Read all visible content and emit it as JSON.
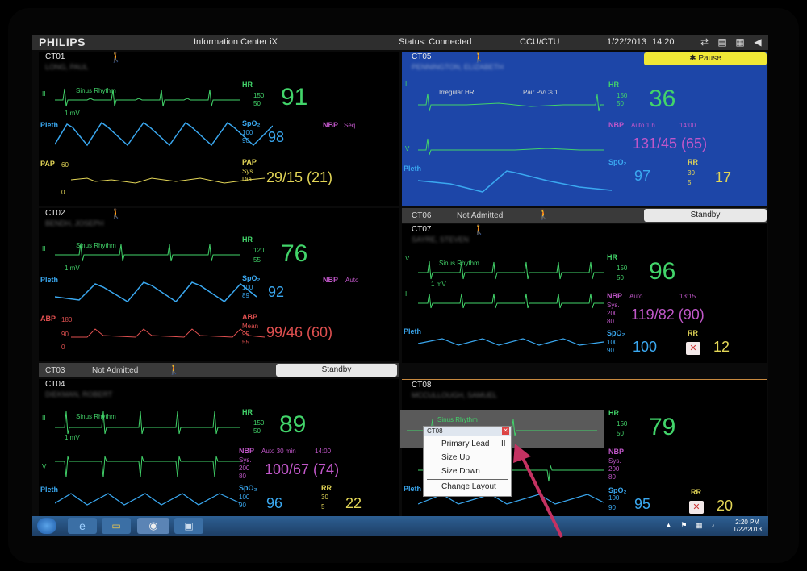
{
  "topbar": {
    "brand": "PHILIPS",
    "app": "Information Center iX",
    "status": "Status: Connected",
    "unit": "CCU/CTU",
    "date": "1/22/2013",
    "time": "14:20"
  },
  "tiles": {
    "ct01": {
      "bed": "CT01",
      "patient": "LONG, PAUL",
      "rhythm": "Sinus Rhythm",
      "hr_label": "HR",
      "hr_hi": "150",
      "hr_lo": "50",
      "hr": "91",
      "spo2_label": "SpO₂",
      "spo2_hi": "100",
      "spo2_lo": "90",
      "spo2": "98",
      "nbp_label": "NBP",
      "nbp_mode": "Seq.",
      "pap_label": "PAP",
      "pap_sys": "Sys.",
      "pap_dia": "Dia.",
      "pap": "29/15 (21)",
      "lead": "II",
      "mv": "1 mV",
      "pleth": "Pleth",
      "pap_wl": "PAP",
      "pap_60": "60",
      "pap_0": "0"
    },
    "ct05": {
      "bed": "CT05",
      "patient": "PENNINGTON, ELIZABETH",
      "pause": "✱ Pause",
      "rhythm": "Irregular HR",
      "event": "Pair PVCs 1",
      "hr_label": "HR",
      "hr_hi": "150",
      "hr_lo": "50",
      "hr": "36",
      "nbp_label": "NBP",
      "nbp_mode": "Auto 1 h",
      "nbp_time": "14:00",
      "nbp": "131/45 (65)",
      "spo2_label": "SpO₂",
      "spo2": "97",
      "rr_label": "RR",
      "rr_hi": "30",
      "rr_lo": "5",
      "rr": "17",
      "lead_ii": "II",
      "lead_v": "V",
      "pleth": "Pleth"
    },
    "ct02": {
      "bed": "CT02",
      "patient": "BENDH, JOSEPH",
      "rhythm": "Sinus Rhythm",
      "hr_label": "HR",
      "hr_hi": "120",
      "hr_lo": "55",
      "hr": "76",
      "spo2_label": "SpO₂",
      "spo2_hi": "100",
      "spo2_lo": "89",
      "spo2": "92",
      "nbp_label": "NBP",
      "nbp_mode": "Auto",
      "abp_label": "ABP",
      "abp_mean": "Mean",
      "abp_hi": "95",
      "abp_lo": "55",
      "abp": "99/46 (60)",
      "lead": "II",
      "mv": "1 mV",
      "pleth": "Pleth",
      "abp_wl": "ABP",
      "abp_180": "180",
      "abp_90": "90",
      "abp_0": "0"
    },
    "ct06": {
      "bed": "CT06",
      "status": "Not Admitted",
      "button": "Standby"
    },
    "ct07": {
      "bed": "CT07",
      "patient": "SAYRE, STEVEN",
      "rhythm": "Sinus Rhythm",
      "hr_label": "HR",
      "hr_hi": "150",
      "hr_lo": "50",
      "hr": "96",
      "nbp_label": "NBP",
      "nbp_mode": "Auto",
      "nbp_time": "13:15",
      "nbp_sys": "Sys.",
      "nbp_hi": "200",
      "nbp_lo": "80",
      "nbp": "119/82 (90)",
      "spo2_label": "SpO₂",
      "spo2_hi": "100",
      "spo2_lo": "90",
      "spo2": "100",
      "rr_label": "RR",
      "rr": "12",
      "lead_v": "V",
      "lead_ii": "II",
      "mv": "1 mV",
      "pleth": "Pleth"
    },
    "ct03": {
      "bed": "CT03",
      "status": "Not Admitted",
      "button": "Standby"
    },
    "ct04": {
      "bed": "CT04",
      "patient": "DIEKMAN, ROBERT",
      "rhythm": "Sinus Rhythm",
      "hr_label": "HR",
      "hr_hi": "150",
      "hr_lo": "50",
      "hr": "89",
      "nbp_label": "NBP",
      "nbp_mode": "Auto 30 min",
      "nbp_time": "14:00",
      "nbp_sys": "Sys.",
      "nbp_hi": "200",
      "nbp_lo": "80",
      "nbp": "100/67 (74)",
      "spo2_label": "SpO₂",
      "spo2_hi": "100",
      "spo2_lo": "90",
      "spo2": "96",
      "rr_label": "RR",
      "rr_hi": "30",
      "rr_lo": "5",
      "rr": "22",
      "lead": "II",
      "lead_v": "V",
      "mv": "1 mV",
      "pleth": "Pleth"
    },
    "ct08": {
      "bed": "CT08",
      "patient": "MCCULLOUGH, SAMUEL",
      "rhythm": "Sinus Rhythm",
      "hr_label": "HR",
      "hr_hi": "150",
      "hr_lo": "50",
      "hr": "79",
      "nbp_label": "NBP",
      "nbp_sys": "Sys.",
      "nbp_hi": "200",
      "nbp_lo": "80",
      "spo2_label": "SpO₂",
      "spo2_hi": "100",
      "spo2_lo": "90",
      "spo2": "95",
      "rr_label": "RR",
      "rr": "20",
      "lead": "II",
      "pleth": "Pleth"
    }
  },
  "popup": {
    "title": "CT08",
    "items": [
      "Primary Lead",
      "Size Up",
      "Size Down",
      "Change Layout"
    ],
    "primary_value": "II"
  },
  "taskbar": {
    "time": "2:20 PM",
    "date": "1/22/2013"
  },
  "colors": {
    "hr": "#42d46a",
    "spo2": "#3aa8f0",
    "nbp": "#c157c9",
    "rr": "#e3d657",
    "abp": "#e05050",
    "pause": "#f0e836",
    "tile_blue": "#1d46a8"
  }
}
